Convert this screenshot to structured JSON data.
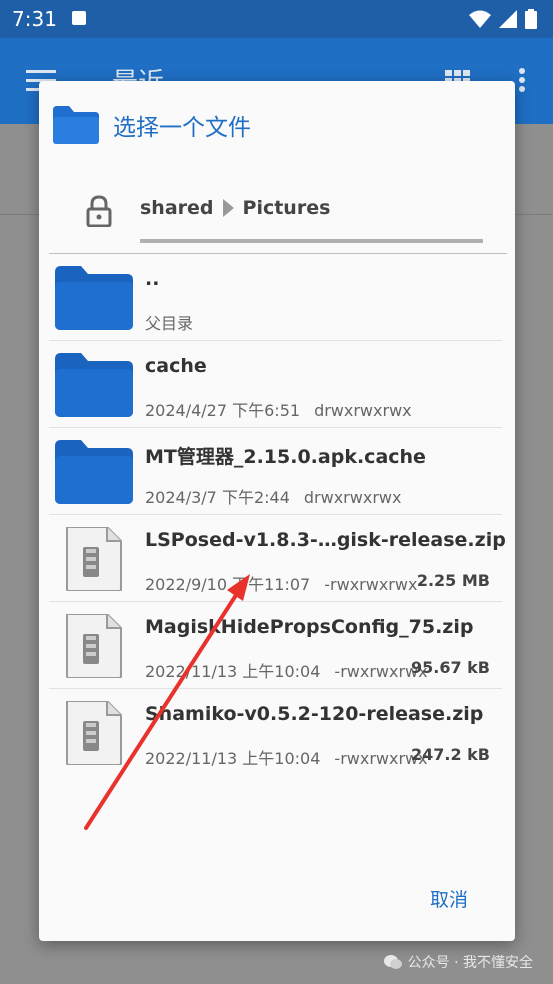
{
  "status_bar": {
    "time": "7:31"
  },
  "app_bar": {
    "title": "最近"
  },
  "dialog": {
    "title": "选择一个文件",
    "breadcrumbs": [
      "shared",
      "Pictures"
    ],
    "cancel_label": "取消"
  },
  "files": [
    {
      "type": "folder",
      "name": "..",
      "date": "父目录",
      "perm": "",
      "size": ""
    },
    {
      "type": "folder",
      "name": "cache",
      "date": "2024/4/27 下午6:51",
      "perm": "drwxrwxrwx",
      "size": ""
    },
    {
      "type": "folder",
      "name": "MT管理器_2.15.0.apk.cache",
      "date": "2024/3/7 下午2:44",
      "perm": "drwxrwxrwx",
      "size": ""
    },
    {
      "type": "zip",
      "name": "LSPosed-v1.8.3-…gisk-release.zip",
      "date": "2022/9/10 下午11:07",
      "perm": "-rwxrwxrwx",
      "size": "2.25 MB"
    },
    {
      "type": "zip",
      "name": "MagiskHidePropsConfig_75.zip",
      "date": "2022/11/13 上午10:04",
      "perm": "-rwxrwxrwx",
      "size": "95.67 kB"
    },
    {
      "type": "zip",
      "name": "Shamiko-v0.5.2-120-release.zip",
      "date": "2022/11/13 上午10:04",
      "perm": "-rwxrwxrwx",
      "size": "247.2 kB"
    }
  ],
  "watermark": "公众号 · 我不懂安全",
  "colors": {
    "accent": "#1f6fc5",
    "folder": "#1e6fd0",
    "annotation_arrow": "#e8322b"
  }
}
